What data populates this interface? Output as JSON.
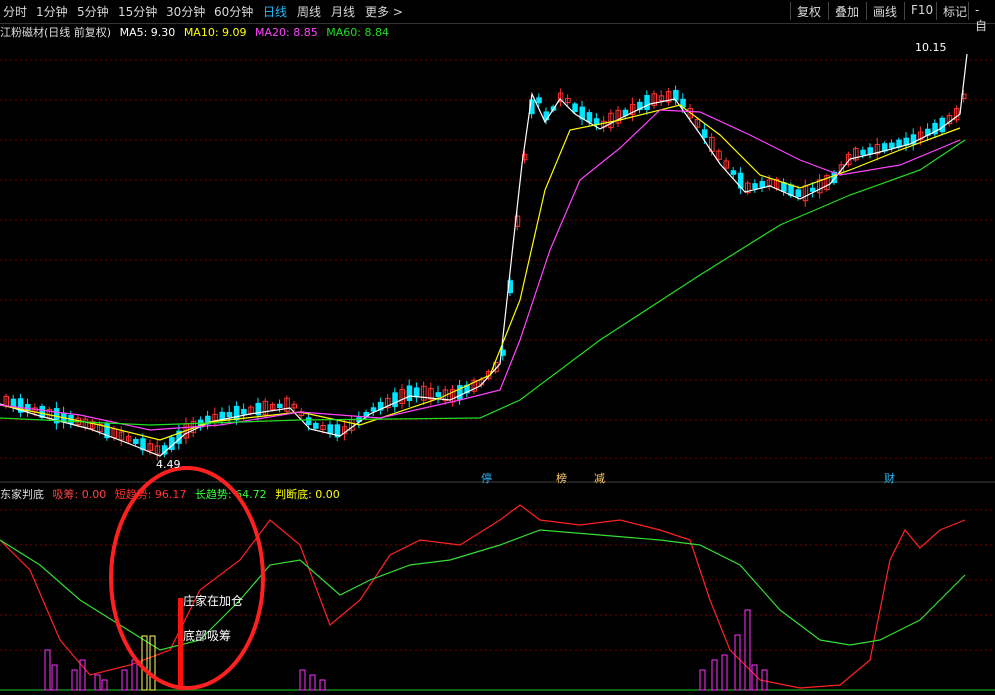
{
  "toolbar": {
    "periods": [
      "分时",
      "1分钟",
      "5分钟",
      "15分钟",
      "30分钟",
      "60分钟",
      "日线",
      "周线",
      "月线",
      "更多"
    ],
    "active_period": "日线",
    "tools": [
      "复权",
      "叠加",
      "画线",
      "F10",
      "标记",
      "-自"
    ]
  },
  "main_header": {
    "title": "江粉磁材(日线 前复权)",
    "ma": [
      {
        "label": "MA5: 9.30",
        "color": "#ffffff"
      },
      {
        "label": "MA10: 9.09",
        "color": "#ffff00"
      },
      {
        "label": "MA20: 8.85",
        "color": "#ff44ff"
      },
      {
        "label": "MA60: 8.84",
        "color": "#22dd22"
      }
    ]
  },
  "price_labels": {
    "high": "10.15",
    "low": "4.49"
  },
  "event_markers": [
    "停",
    "榜",
    "减",
    "财"
  ],
  "indicator_header": {
    "name": "东家判底",
    "items": [
      {
        "label": "吸筹: 0.00",
        "color": "#ff4444"
      },
      {
        "label": "短趋势: 96.17",
        "color": "#ff3333"
      },
      {
        "label": "长趋势: 64.72",
        "color": "#33ff33"
      },
      {
        "label": "判断底: 0.00",
        "color": "#ffff00"
      }
    ]
  },
  "annotations": {
    "signal1": "庄家在加仓",
    "signal2": "底部吸筹"
  },
  "colors": {
    "up": "#ff3333",
    "down": "#00e5ff",
    "grid": "#7a0000",
    "highlight_circle": "#ff2020"
  }
}
